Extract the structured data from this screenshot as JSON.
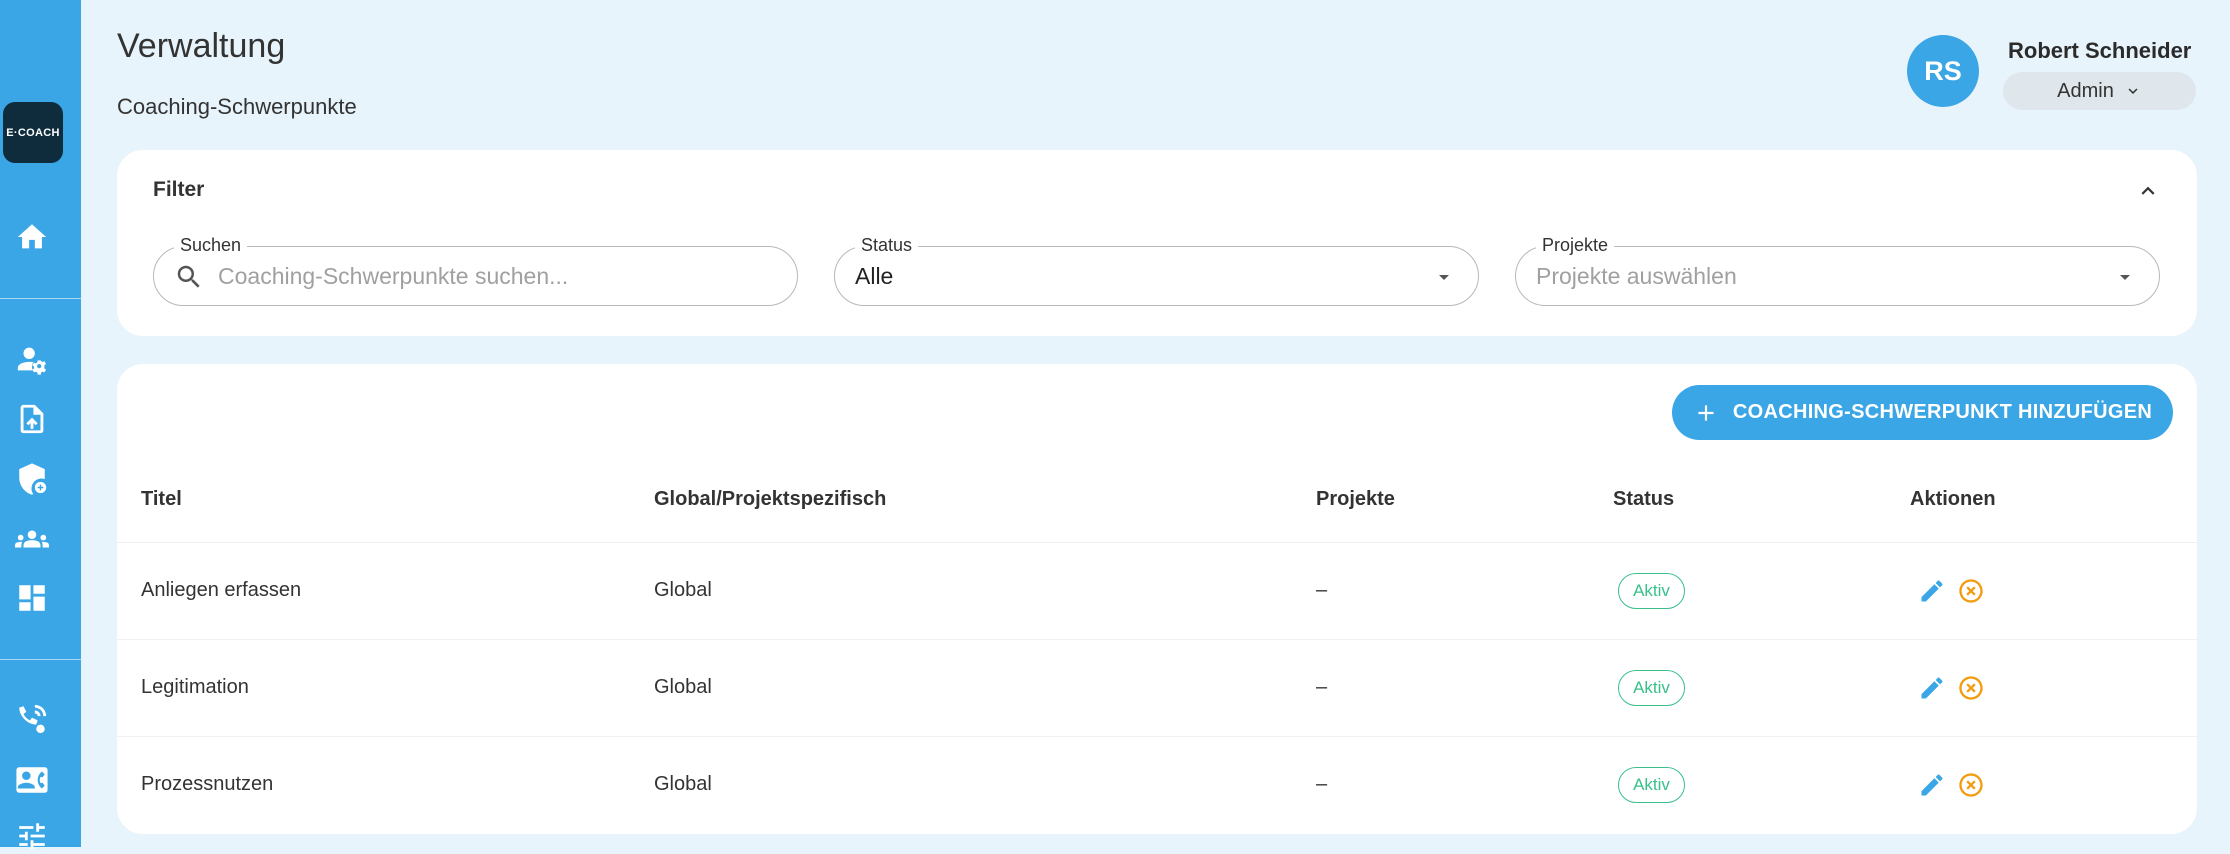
{
  "sidebar": {
    "logo_text": "E·COACH",
    "items": [
      {
        "icon": "home-icon"
      },
      {
        "icon": "user-settings-icon"
      },
      {
        "icon": "file-upload-icon"
      },
      {
        "icon": "shield-add-icon"
      },
      {
        "icon": "group-icon"
      },
      {
        "icon": "dashboard-icon"
      },
      {
        "icon": "call-icon"
      },
      {
        "icon": "contact-card-icon"
      },
      {
        "icon": "sliders-icon"
      }
    ],
    "color": "#3aa6e6"
  },
  "header": {
    "title": "Verwaltung",
    "subtitle": "Coaching-Schwerpunkte"
  },
  "user": {
    "initials": "RS",
    "name": "Robert Schneider",
    "role": "Admin"
  },
  "filter": {
    "title": "Filter",
    "search": {
      "label": "Suchen",
      "placeholder": "Coaching-Schwerpunkte suchen..."
    },
    "status": {
      "label": "Status",
      "value": "Alle"
    },
    "projects": {
      "label": "Projekte",
      "placeholder": "Projekte auswählen"
    }
  },
  "actions": {
    "add_label": "COACHING-SCHWERPUNKT HINZUFÜGEN"
  },
  "table": {
    "columns": [
      "Titel",
      "Global/Projektspezifisch",
      "Projekte",
      "Status",
      "Aktionen"
    ],
    "rows": [
      {
        "title": "Anliegen erfassen",
        "scope": "Global",
        "projects": "–",
        "status": "Aktiv"
      },
      {
        "title": "Legitimation",
        "scope": "Global",
        "projects": "–",
        "status": "Aktiv"
      },
      {
        "title": "Prozessnutzen",
        "scope": "Global",
        "projects": "–",
        "status": "Aktiv"
      }
    ]
  },
  "colors": {
    "accent": "#3aa6e6",
    "status_active": "#39c08a",
    "delete": "#f39c12",
    "edit": "#3aa6e6",
    "background": "#e8f4fb"
  }
}
